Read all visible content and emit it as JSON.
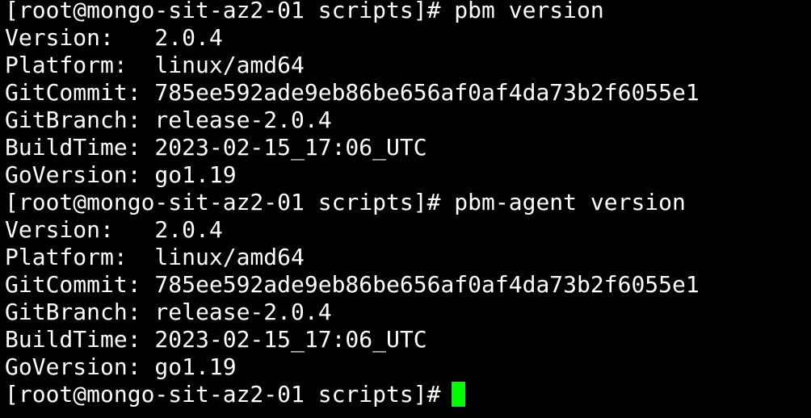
{
  "terminal": {
    "cursor_color": "#00ff00",
    "lines": [
      "[root@mongo-sit-az2-01 scripts]# pbm version",
      "Version:   2.0.4",
      "Platform:  linux/amd64",
      "GitCommit: 785ee592ade9eb86be656af0af4da73b2f6055e1",
      "GitBranch: release-2.0.4",
      "BuildTime: 2023-02-15_17:06_UTC",
      "GoVersion: go1.19",
      "[root@mongo-sit-az2-01 scripts]# pbm-agent version",
      "Version:   2.0.4",
      "Platform:  linux/amd64",
      "GitCommit: 785ee592ade9eb86be656af0af4da73b2f6055e1",
      "GitBranch: release-2.0.4",
      "BuildTime: 2023-02-15_17:06_UTC",
      "GoVersion: go1.19"
    ],
    "prompt": "[root@mongo-sit-az2-01 scripts]#"
  }
}
